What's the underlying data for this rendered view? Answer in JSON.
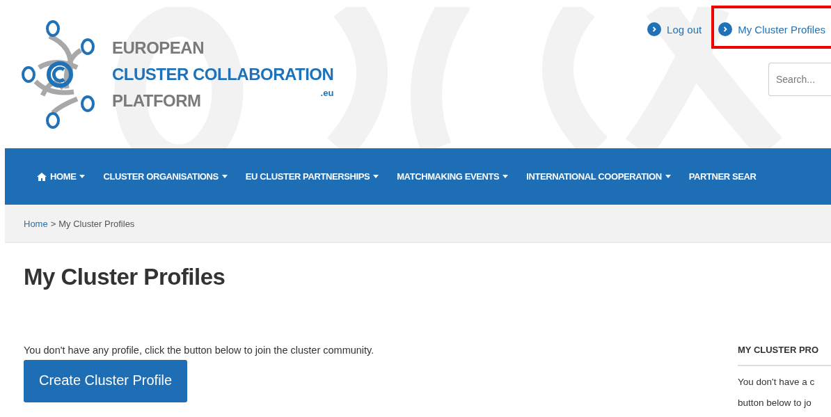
{
  "logo": {
    "line_1": "EUROPEAN",
    "line_2": "CLUSTER COLLABORATION",
    "line_3": "PLATFORM",
    "suffix": ".eu"
  },
  "top_links": [
    {
      "label": "Log out",
      "highlighted": false
    },
    {
      "label": "My Cluster Profiles",
      "highlighted": true
    }
  ],
  "search": {
    "placeholder": "Search..."
  },
  "nav": [
    {
      "label": "HOME",
      "kind": "home",
      "dropdown": true
    },
    {
      "label": "CLUSTER ORGANISATIONS",
      "kind": "plain",
      "dropdown": true
    },
    {
      "label": "EU CLUSTER PARTNERSHIPS",
      "kind": "plain",
      "dropdown": true
    },
    {
      "label": "MATCHMAKING EVENTS",
      "kind": "plain",
      "dropdown": true
    },
    {
      "label": "INTERNATIONAL COOPERATION",
      "kind": "plain",
      "dropdown": true
    },
    {
      "label": "PARTNER SEAR",
      "kind": "plain",
      "dropdown": false
    }
  ],
  "breadcrumb": {
    "link": "Home",
    "separator": ">",
    "current": "My Cluster Profiles"
  },
  "page_title": "My Cluster Profiles",
  "message": "You don't have any profile, click the button below to join the cluster community.",
  "create_button": "Create Cluster Profile",
  "sidebar": {
    "title": "MY CLUSTER PRO",
    "lines": [
      "You don't have a c",
      "button below to jo"
    ]
  }
}
